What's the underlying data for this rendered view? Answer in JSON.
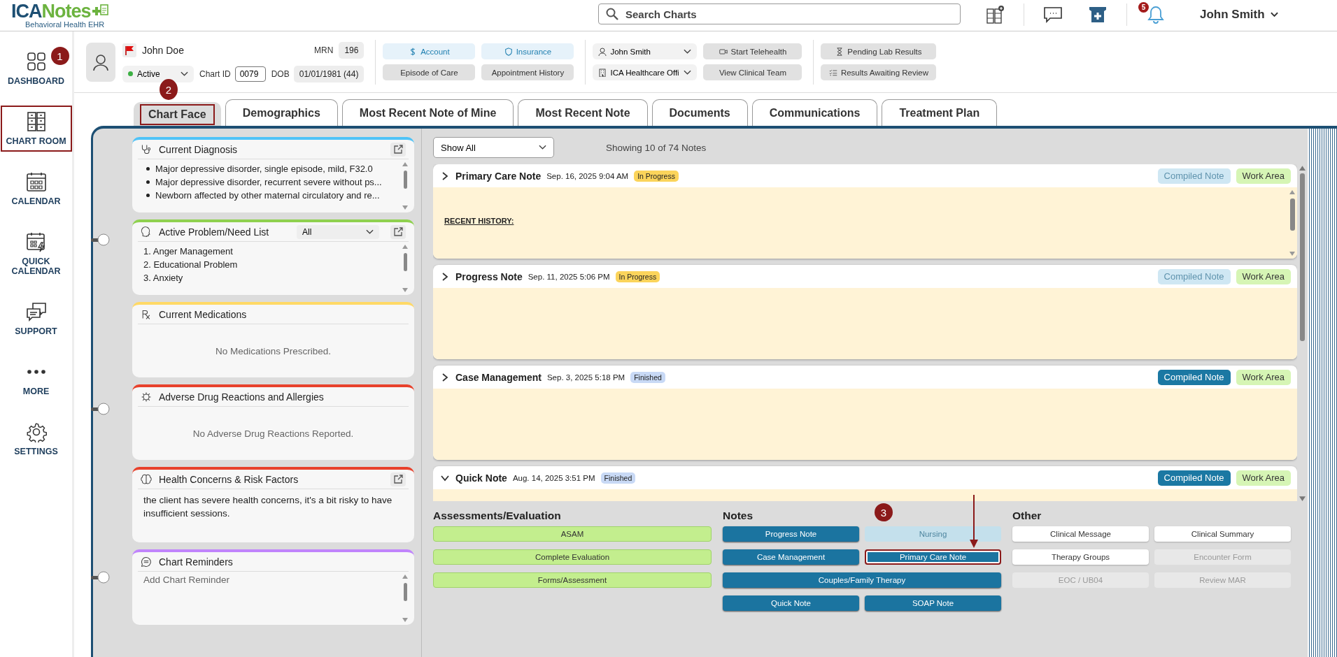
{
  "header": {
    "logo": {
      "primary": "ICA",
      "secondary": "Notes",
      "tagline": "Behavioral Health EHR"
    },
    "search": {
      "placeholder": "Search Charts"
    },
    "notification_count": "5",
    "user": "John Smith"
  },
  "sidebar": {
    "items": [
      {
        "label": "DASHBOARD",
        "highlighted": false,
        "callout": "1"
      },
      {
        "label": "CHART ROOM",
        "highlighted": true
      },
      {
        "label": "CALENDAR",
        "highlighted": false
      },
      {
        "label": "QUICK CALENDAR",
        "highlighted": false
      },
      {
        "label": "SUPPORT",
        "highlighted": false
      },
      {
        "label": "MORE",
        "highlighted": false
      },
      {
        "label": "SETTINGS",
        "highlighted": false
      }
    ]
  },
  "patient": {
    "name": "John Doe",
    "flagged": true,
    "status": "Active",
    "chart_id_label": "Chart ID",
    "chart_id": "0079",
    "mrn_label": "MRN",
    "mrn": "196",
    "dob_label": "DOB",
    "dob": "01/01/1981 (44)",
    "account_buttons": [
      {
        "label": "Account",
        "kind": "link"
      },
      {
        "label": "Insurance",
        "kind": "link"
      },
      {
        "label": "Episode of Care",
        "kind": "plain"
      },
      {
        "label": "Appointment History",
        "kind": "plain"
      }
    ],
    "provider": "John Smith",
    "location": "ICA Healthcare Offi",
    "care_buttons": [
      "Start Telehealth",
      "View Clinical Team"
    ],
    "lab_buttons": [
      "Pending Lab Results",
      "Results Awaiting Review"
    ]
  },
  "tabs": [
    {
      "label": "Chart Face",
      "selected": true,
      "highlighted": true,
      "callout": "2"
    },
    {
      "label": "Demographics",
      "selected": false,
      "highlighted": false
    },
    {
      "label": "Most Recent Note of Mine",
      "selected": false,
      "highlighted": false
    },
    {
      "label": "Most Recent Note",
      "selected": false,
      "highlighted": false
    },
    {
      "label": "Documents",
      "selected": false,
      "highlighted": false
    },
    {
      "label": "Communications",
      "selected": false,
      "highlighted": false
    },
    {
      "label": "Treatment Plan",
      "selected": false,
      "highlighted": false
    }
  ],
  "panels": [
    {
      "title": "Current Diagnosis",
      "color": "#4fc3f7",
      "popout": true,
      "kind": "bullets",
      "items": [
        "Major depressive disorder, single episode, mild, F32.0",
        "Major depressive disorder, recurrent severe without ps...",
        "Newborn affected by other maternal circulatory and re..."
      ]
    },
    {
      "title": "Active Problem/Need List",
      "color": "#8fd14f",
      "popout": true,
      "filter": "All",
      "kind": "lines",
      "items": [
        "1. Anger Management",
        "2. Educational Problem",
        "3. Anxiety"
      ]
    },
    {
      "title": "Current Medications",
      "color": "#ffd966",
      "popout": false,
      "kind": "empty",
      "message": "No Medications Prescribed."
    },
    {
      "title": "Adverse Drug Reactions and Allergies",
      "color": "#e8412c",
      "popout": false,
      "kind": "empty",
      "message": "No Adverse Drug Reactions Reported."
    },
    {
      "title": "Health Concerns & Risk Factors",
      "color": "#e8412c",
      "popout": true,
      "kind": "text",
      "text": "the client has severe health concerns, it's a bit risky to have insufficient sessions."
    },
    {
      "title": "Chart Reminders",
      "color": "#c084fc",
      "popout": false,
      "kind": "input",
      "placeholder": "Add Chart Reminder"
    }
  ],
  "notes": {
    "filter": "Show All",
    "summary": "Showing 10 of 74 Notes",
    "items": [
      {
        "title": "Primary Care Note",
        "date": "Sep. 16, 2025 9:04 AM",
        "status": "In Progress",
        "kind": "in-progress",
        "compiled_label": "Compiled Note",
        "compiled_disabled": true,
        "work_label": "Work Area",
        "expanded": false,
        "body": "RECENT HISTORY:"
      },
      {
        "title": "Progress Note",
        "date": "Sep. 11, 2025 5:06 PM",
        "status": "In Progress",
        "kind": "in-progress",
        "compiled_label": "Compiled Note",
        "compiled_disabled": true,
        "work_label": "Work Area",
        "expanded": false
      },
      {
        "title": "Case Management",
        "date": "Sep. 3, 2025 5:18 PM",
        "status": "Finished",
        "kind": "finished",
        "compiled_label": "Compiled Note",
        "compiled_disabled": false,
        "work_label": "Work Area",
        "expanded": false
      },
      {
        "title": "Quick Note",
        "date": "Aug. 14, 2025 3:51 PM",
        "status": "Finished",
        "kind": "finished",
        "compiled_label": "Compiled Note",
        "compiled_disabled": false,
        "work_label": "Work Area",
        "expanded": true
      }
    ]
  },
  "actions": [
    {
      "title": "Assessments/Evaluation",
      "buttons": [
        {
          "label": "ASAM",
          "kind": "green",
          "disabled": false,
          "wide": true,
          "highlighted": false
        },
        {
          "label": "Complete Evaluation",
          "kind": "green",
          "disabled": false,
          "wide": true,
          "highlighted": false
        },
        {
          "label": "Forms/Assessment",
          "kind": "green",
          "disabled": false,
          "wide": true,
          "highlighted": false
        }
      ]
    },
    {
      "title": "Notes",
      "buttons": [
        {
          "label": "Progress Note",
          "kind": "blue",
          "disabled": false,
          "wide": false,
          "highlighted": false
        },
        {
          "label": "Nursing",
          "kind": "blue",
          "disabled": true,
          "wide": false,
          "highlighted": false
        },
        {
          "label": "Case Management",
          "kind": "blue",
          "disabled": false,
          "wide": false,
          "highlighted": false
        },
        {
          "label": "Primary Care Note",
          "kind": "blue",
          "disabled": false,
          "wide": false,
          "highlighted": true,
          "callout": "3"
        },
        {
          "label": "Couples/Family Therapy",
          "kind": "blue",
          "disabled": false,
          "wide": true,
          "highlighted": false
        },
        {
          "label": "Quick Note",
          "kind": "blue",
          "disabled": false,
          "wide": false,
          "highlighted": false
        },
        {
          "label": "SOAP Note",
          "kind": "blue",
          "disabled": false,
          "wide": false,
          "highlighted": false
        }
      ]
    },
    {
      "title": "Other",
      "buttons": [
        {
          "label": "Clinical Message",
          "kind": "white",
          "disabled": false,
          "wide": false,
          "highlighted": false
        },
        {
          "label": "Clinical Summary",
          "kind": "white",
          "disabled": false,
          "wide": false,
          "highlighted": false
        },
        {
          "label": "Therapy Groups",
          "kind": "white",
          "disabled": false,
          "wide": false,
          "highlighted": false
        },
        {
          "label": "Encounter Form",
          "kind": "white",
          "disabled": true,
          "wide": false,
          "highlighted": false
        },
        {
          "label": "EOC / UB04",
          "kind": "white",
          "disabled": true,
          "wide": false,
          "highlighted": false
        },
        {
          "label": "Review MAR",
          "kind": "white",
          "disabled": true,
          "wide": false,
          "highlighted": false
        }
      ]
    }
  ]
}
